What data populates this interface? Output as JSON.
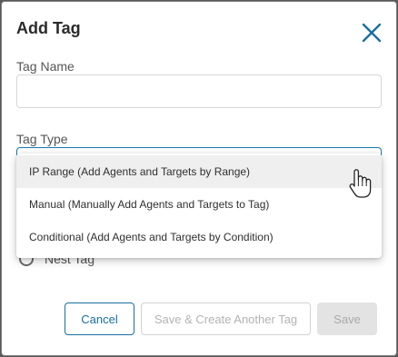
{
  "dialog": {
    "title": "Add Tag",
    "close_icon": "close-icon"
  },
  "form": {
    "tag_name_label": "Tag Name",
    "tag_name_value": "",
    "tag_type_label": "Tag Type",
    "nest_tag_label": "Nest Tag"
  },
  "dropdown": {
    "options": [
      {
        "label": "IP Range (Add Agents and Targets by Range)",
        "hovered": true
      },
      {
        "label": "Manual (Manually Add Agents and Targets to Tag)",
        "hovered": false
      },
      {
        "label": "Conditional (Add Agents and Targets by Condition)",
        "hovered": false
      }
    ]
  },
  "buttons": {
    "cancel": "Cancel",
    "save_create_another": "Save & Create Another Tag",
    "save": "Save"
  },
  "colors": {
    "accent": "#1a6f9e",
    "focus_border": "#1a7ab0",
    "hover_bg": "#efefef",
    "disabled_bg": "#e3e3e3"
  }
}
